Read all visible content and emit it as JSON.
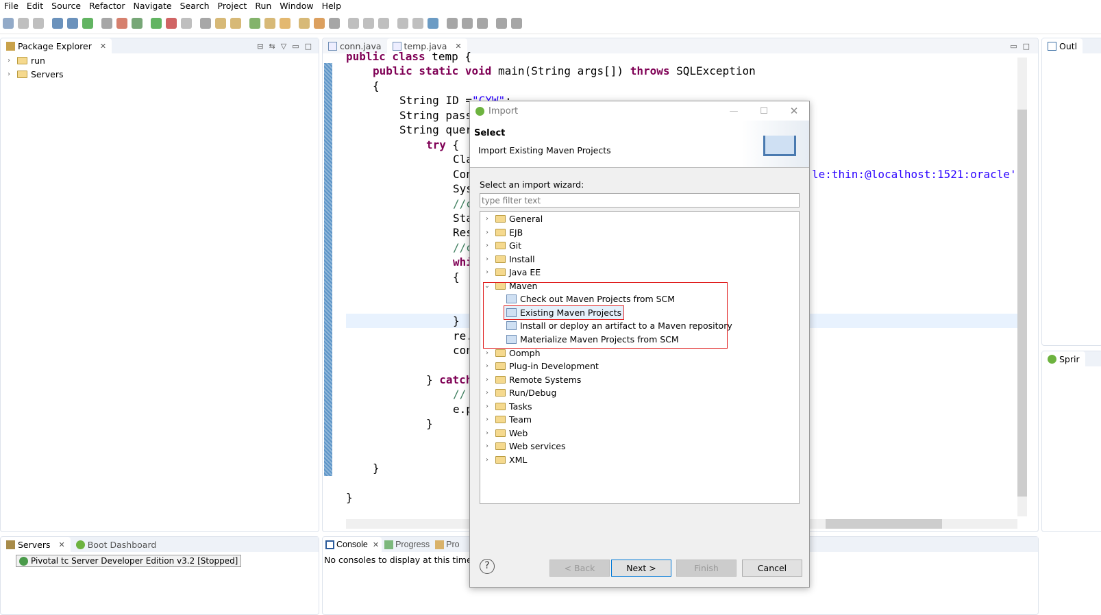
{
  "menu": [
    "File",
    "Edit",
    "Source",
    "Refactor",
    "Navigate",
    "Search",
    "Project",
    "Run",
    "Window",
    "Help"
  ],
  "package_explorer": {
    "title": "Package Explorer",
    "items": [
      "run",
      "Servers"
    ]
  },
  "editor": {
    "tabs": [
      "conn.java",
      "temp.java"
    ],
    "lines": [
      {
        "i": 0,
        "y": 0,
        "t": [
          [
            "kw",
            "public class "
          ],
          [
            "",
            "temp {"
          ]
        ]
      },
      {
        "i": 4,
        "y": 1,
        "t": [
          [
            "kw",
            "public static void "
          ],
          [
            "",
            "main(String "
          ],
          [
            "",
            "args[]) "
          ],
          [
            "kw",
            "throws "
          ],
          [
            "",
            "SQLException"
          ]
        ]
      },
      {
        "i": 4,
        "y": 2,
        "t": [
          [
            "",
            "{"
          ]
        ]
      },
      {
        "i": 8,
        "y": 3,
        "t": [
          [
            "",
            "String ID ="
          ],
          [
            "str",
            "\"CYW\""
          ],
          [
            "",
            ";"
          ]
        ]
      },
      {
        "i": 8,
        "y": 4,
        "t": [
          [
            "",
            "String pass"
          ]
        ]
      },
      {
        "i": 8,
        "y": 5,
        "t": [
          [
            "",
            "String quer"
          ]
        ]
      },
      {
        "i": 12,
        "y": 6,
        "t": [
          [
            "kw",
            "try "
          ],
          [
            "",
            "{"
          ]
        ]
      },
      {
        "i": 16,
        "y": 7,
        "t": [
          [
            "",
            "Cla"
          ]
        ]
      },
      {
        "i": 16,
        "y": 8,
        "t": [
          [
            "",
            "Con"
          ]
        ]
      },
      {
        "i": 16,
        "y": 9,
        "t": [
          [
            "",
            "Sys"
          ]
        ]
      },
      {
        "i": 16,
        "y": 10,
        "t": [
          [
            "cm",
            "//c"
          ]
        ]
      },
      {
        "i": 16,
        "y": 11,
        "t": [
          [
            "",
            "Sta"
          ]
        ]
      },
      {
        "i": 16,
        "y": 12,
        "t": [
          [
            "",
            "Res"
          ]
        ]
      },
      {
        "i": 16,
        "y": 13,
        "t": [
          [
            "cm",
            "//c"
          ]
        ]
      },
      {
        "i": 16,
        "y": 14,
        "t": [
          [
            "kw",
            "whi"
          ]
        ]
      },
      {
        "i": 16,
        "y": 15,
        "t": [
          [
            "",
            "{"
          ]
        ]
      },
      {
        "i": 16,
        "y": 18,
        "t": [
          [
            "",
            "}"
          ]
        ]
      },
      {
        "i": 16,
        "y": 19,
        "t": [
          [
            "",
            "re."
          ]
        ]
      },
      {
        "i": 16,
        "y": 20,
        "t": [
          [
            "",
            "con"
          ]
        ]
      },
      {
        "i": 12,
        "y": 22,
        "t": [
          [
            "",
            "} "
          ],
          [
            "kw",
            "catch"
          ]
        ]
      },
      {
        "i": 16,
        "y": 23,
        "t": [
          [
            "cm",
            "//"
          ]
        ]
      },
      {
        "i": 16,
        "y": 24,
        "t": [
          [
            "",
            "e.p"
          ]
        ]
      },
      {
        "i": 12,
        "y": 25,
        "t": [
          [
            "",
            "}"
          ]
        ]
      },
      {
        "i": 4,
        "y": 28,
        "t": [
          [
            "",
            "}"
          ]
        ]
      },
      {
        "i": 0,
        "y": 30,
        "t": [
          [
            "",
            "}"
          ]
        ]
      }
    ],
    "right_fragment": "le:thin:@localhost:1521:oracle'"
  },
  "outline": {
    "title": "Outl"
  },
  "spring": {
    "title": "Sprir"
  },
  "servers_panel": {
    "tabs": [
      "Servers",
      "Boot Dashboard"
    ],
    "items": [
      "Pivotal tc Server Developer Edition v3.2  [Stopped]"
    ]
  },
  "console_panel": {
    "tabs": [
      "Console",
      "Progress",
      "Pro"
    ],
    "message": "No consoles to display at this time."
  },
  "dialog": {
    "title": "Import",
    "heading": "Select",
    "subheading": "Import Existing Maven Projects",
    "wizard_label": "Select an import wizard:",
    "filter_placeholder": "type filter text",
    "tree": [
      {
        "label": "General",
        "type": "folder"
      },
      {
        "label": "EJB",
        "type": "folder"
      },
      {
        "label": "Git",
        "type": "folder"
      },
      {
        "label": "Install",
        "type": "folder"
      },
      {
        "label": "Java EE",
        "type": "folder"
      },
      {
        "label": "Maven",
        "type": "folder",
        "expanded": true
      },
      {
        "label": "Check out Maven Projects from SCM",
        "type": "child"
      },
      {
        "label": "Existing Maven Projects",
        "type": "child",
        "selected": true
      },
      {
        "label": "Install or deploy an artifact to a Maven repository",
        "type": "child"
      },
      {
        "label": "Materialize Maven Projects from SCM",
        "type": "child"
      },
      {
        "label": "Oomph",
        "type": "folder"
      },
      {
        "label": "Plug-in Development",
        "type": "folder"
      },
      {
        "label": "Remote Systems",
        "type": "folder"
      },
      {
        "label": "Run/Debug",
        "type": "folder"
      },
      {
        "label": "Tasks",
        "type": "folder"
      },
      {
        "label": "Team",
        "type": "folder"
      },
      {
        "label": "Web",
        "type": "folder"
      },
      {
        "label": "Web services",
        "type": "folder"
      },
      {
        "label": "XML",
        "type": "folder"
      }
    ],
    "buttons": {
      "back": "< Back",
      "next": "Next >",
      "finish": "Finish",
      "cancel": "Cancel"
    },
    "help": "?",
    "highlight_color": "#e02020"
  }
}
